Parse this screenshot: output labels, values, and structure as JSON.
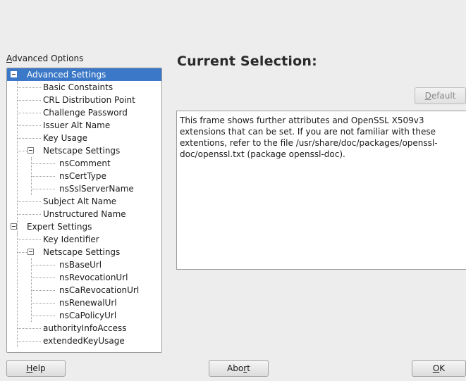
{
  "tree_label": {
    "accel": "A",
    "rest": "dvanced Options"
  },
  "heading": "Current Selection:",
  "default_button": {
    "accel": "D",
    "rest": "efault"
  },
  "info_text": "This frame shows further attributes and OpenSSL X509v3 extensions that can be set. If you are not familiar with these extentions, refer to the file /usr/share/doc/packages/openssl-doc/openssl.txt (package openssl-doc).",
  "tree_items": [
    "Advanced Settings",
    "Basic Constaints",
    "CRL Distribution Point",
    "Challenge Password",
    "Issuer Alt Name",
    "Key Usage",
    "Netscape Settings",
    "nsComment",
    "nsCertType",
    "nsSslServerName",
    "Subject Alt Name",
    "Unstructured Name",
    "Expert Settings",
    "Key Identifier",
    "Netscape Settings",
    "nsBaseUrl",
    "nsRevocationUrl",
    "nsCaRevocationUrl",
    "nsRenewalUrl",
    "nsCaPolicyUrl",
    "authorityInfoAccess",
    "extendedKeyUsage"
  ],
  "buttons": {
    "help": {
      "accel": "H",
      "rest": "elp"
    },
    "abort": {
      "pre": "Abo",
      "accel": "r",
      "post": "t"
    },
    "ok": {
      "accel": "O",
      "rest": "K"
    }
  },
  "colors": {
    "selection": "#3b78c7",
    "window": "#ededed"
  }
}
